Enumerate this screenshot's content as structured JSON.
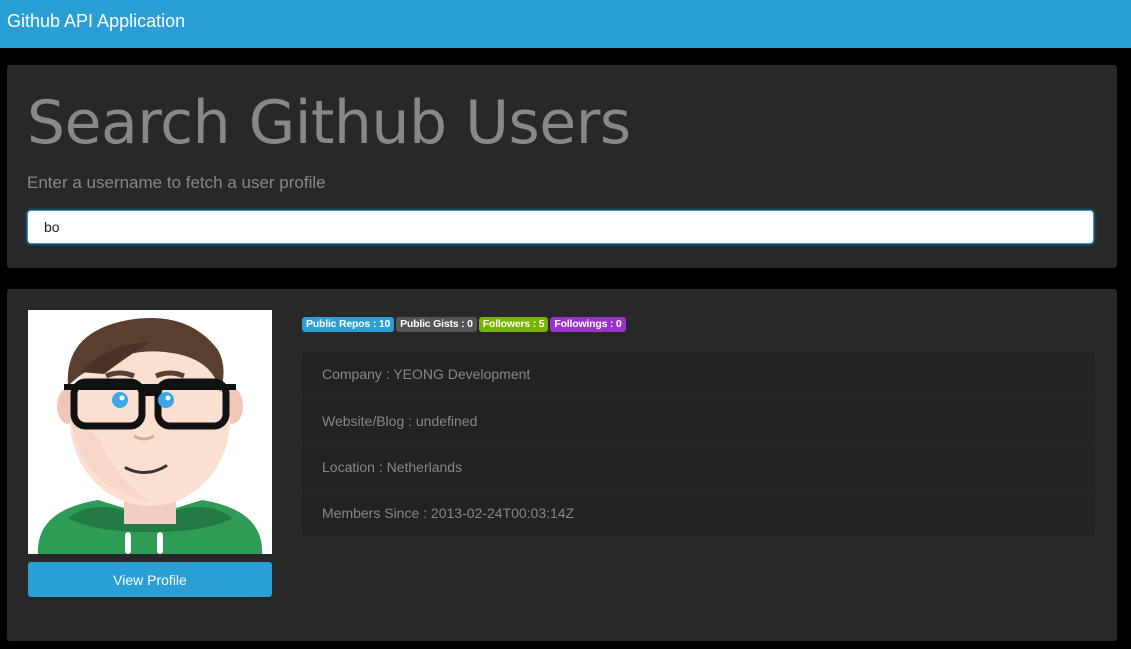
{
  "navbar": {
    "brand": "Github API Application"
  },
  "search": {
    "title": "Search Github Users",
    "subtitle": "Enter a username to fetch a user profile",
    "value": "bo"
  },
  "profile": {
    "view_profile_label": "View Profile",
    "badges": [
      {
        "label": "Public Repos : 10",
        "color": "#2a9fd6"
      },
      {
        "label": "Public Gists : 0",
        "color": "#555555"
      },
      {
        "label": "Followers : 5",
        "color": "#77b300"
      },
      {
        "label": "Followings : 0",
        "color": "#9933cc"
      }
    ],
    "details": [
      "Company : YEONG Development",
      "Website/Blog : undefined",
      "Location : Netherlands",
      "Members Since : 2013-02-24T00:03:14Z"
    ]
  },
  "colors": {
    "primary": "#2a9fd6",
    "background": "#000000",
    "panel": "#282828",
    "muted_text": "#888888"
  }
}
